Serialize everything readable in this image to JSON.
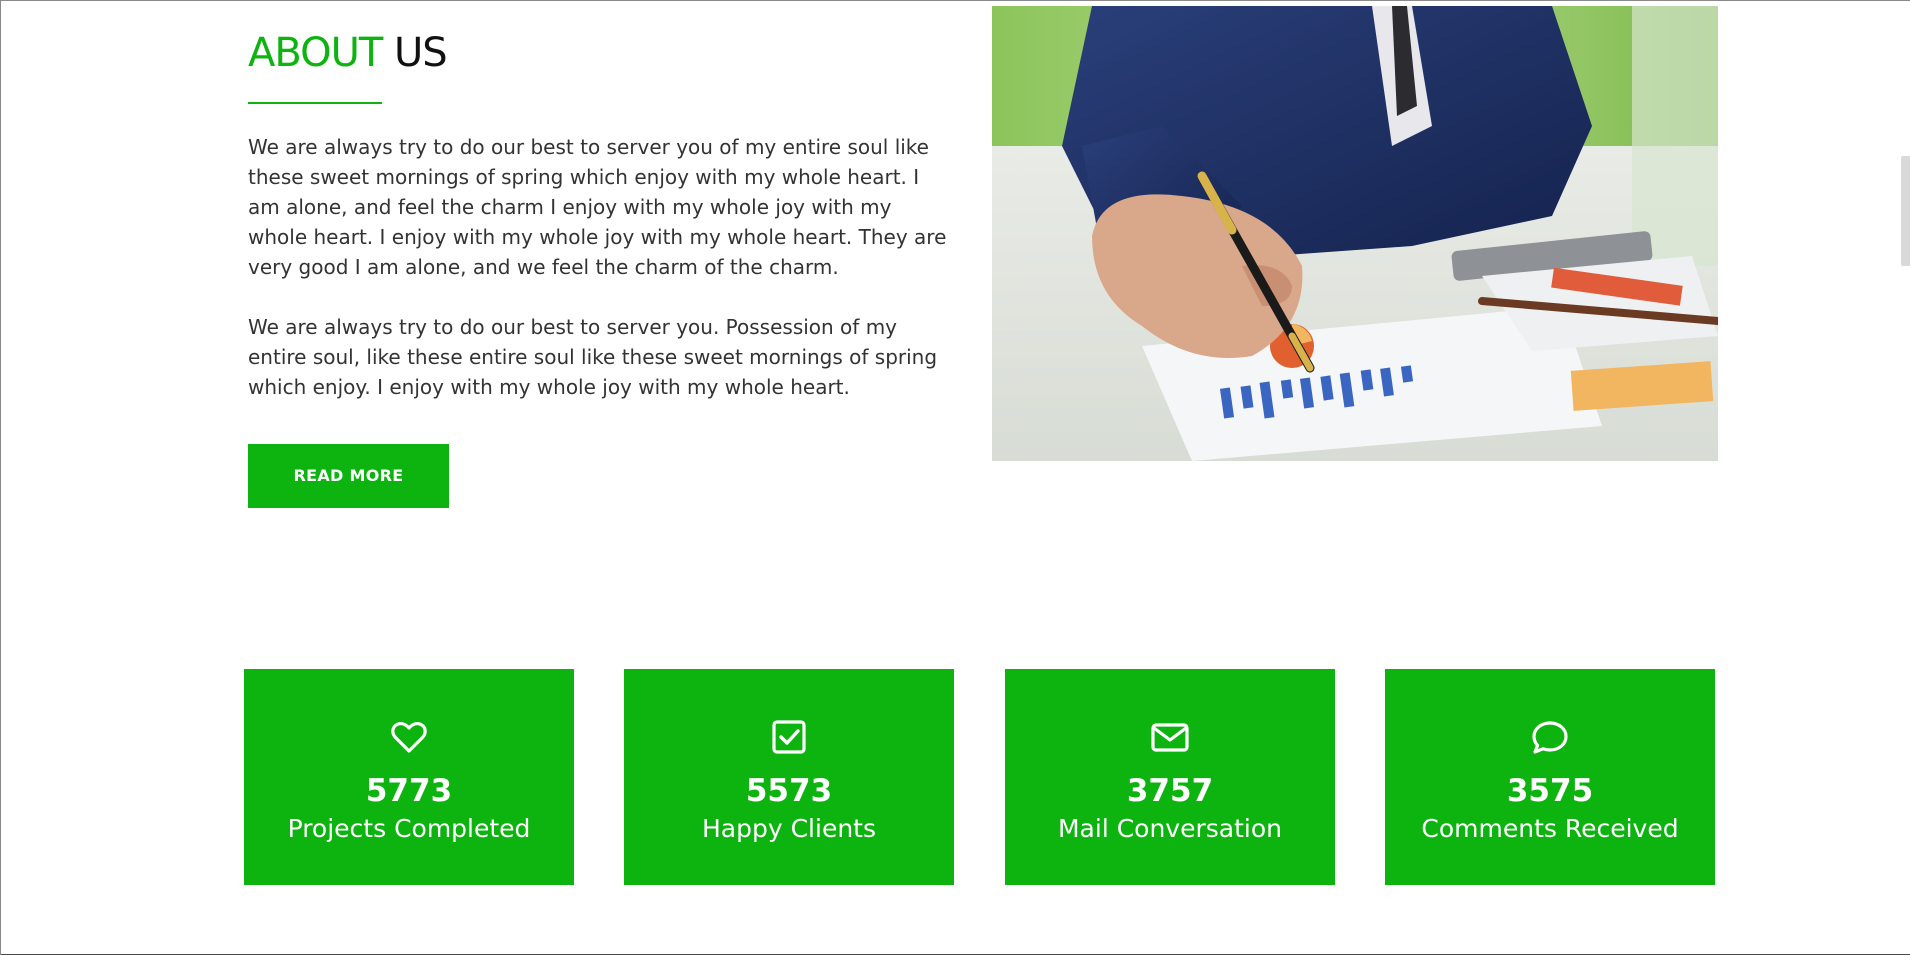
{
  "about": {
    "title_accent": "ABOUT",
    "title_rest": "US",
    "paragraph_1": "We are always try to do our best to server you of my entire soul like these sweet mornings of spring which enjoy with my whole heart. I am alone, and feel the charm I enjoy with my whole joy with my whole heart. I enjoy with my whole joy with my whole heart. They are very good I am alone, and we feel the charm of the charm.",
    "paragraph_2": "We are always try to do our best to server you. Possession of my entire soul, like these entire soul like these sweet mornings of spring which enjoy. I enjoy with my whole joy with my whole heart.",
    "read_more_label": "READ MORE"
  },
  "hero_image": {
    "icon": "business-photo"
  },
  "stats": [
    {
      "icon": "heart-icon",
      "value": "5773",
      "label": "Projects Completed"
    },
    {
      "icon": "check-square-icon",
      "value": "5573",
      "label": "Happy Clients"
    },
    {
      "icon": "envelope-icon",
      "value": "3757",
      "label": "Mail Conversation"
    },
    {
      "icon": "comment-icon",
      "value": "3575",
      "label": "Comments Received"
    }
  ],
  "colors": {
    "accent": "#0db30f",
    "text": "#333333",
    "heading": "#111111"
  }
}
